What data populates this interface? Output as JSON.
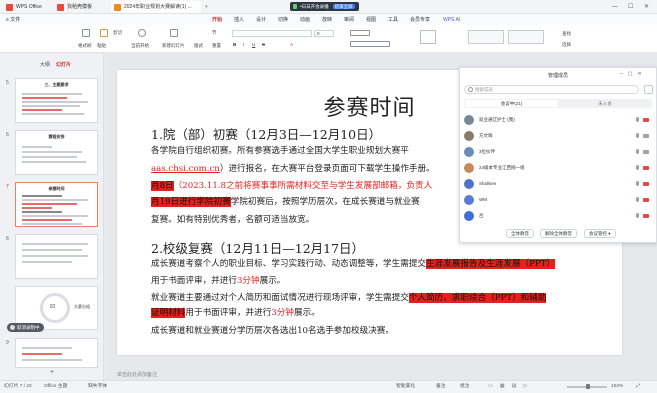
{
  "tabs": [
    {
      "label": "WPS Office",
      "color": "#e84b3c"
    },
    {
      "label": "找稻壳模板",
      "color": "#e84b3c"
    },
    {
      "label": "2024年职业规划大赛解读(1) ...",
      "color": "#f08a24"
    }
  ],
  "meeting_badge": {
    "label": "•日日开会录播",
    "fullscreen": "结束全屏"
  },
  "window_controls": {
    "min": "—",
    "max": "☐",
    "close": "✕"
  },
  "menu": {
    "file": "≡ 文件",
    "items": [
      "开始",
      "插入",
      "设计",
      "切换",
      "动画",
      "放映",
      "审阅",
      "视图",
      "工具",
      "会员专享"
    ],
    "ai": "WPS AI",
    "active": "开始"
  },
  "toolbar": {
    "format_painter": "格式刷",
    "paste": "粘贴",
    "cut": "剪切",
    "current_start": "当前开始",
    "new_slide": "新建幻灯片",
    "layout": "版式",
    "section": "节",
    "reset": "重置",
    "font_size": "0",
    "find": "查找",
    "select": "选择"
  },
  "left_panel": {
    "tabs": [
      "大纲",
      "幻灯片"
    ],
    "active_tab": "幻灯片",
    "thumbs": [
      {
        "num": "5",
        "title": "三、主题要求"
      },
      {
        "num": "6",
        "title": "赛程安排"
      },
      {
        "num": "7",
        "title": "参赛时间"
      },
      {
        "num": "8",
        "title": ""
      },
      {
        "num": "9",
        "title": ""
      }
    ],
    "mini_chart_value": "82",
    "mini_chart_label": "大赛分组",
    "recording_label": "取消录制中"
  },
  "slide": {
    "title": "参赛时间",
    "sec1_heading": "1.院（部）初赛（12月3日—12月10日）",
    "p1_line1": "各学院自行组织初赛。所有参赛选手通过全国大学生职业规划大赛平",
    "p1_line2_link": "aas.chsi.com.cn",
    "p1_line2_rest": "）进行报名，在大赛平台登录页面可下载学生操作手册。",
    "p1_line3_hl": "月8日",
    "p1_line3_red": "（2023.11.8之前将赛事事所需材料交至与学生发展部邮箱，负责人",
    "p1_line4_hl": "月19日进行学院初赛",
    "p1_line4_rest": "学院初赛后，按照学历层次，在成长赛道与就业赛",
    "p1_line5": "复赛。如有特别优秀者，名额可适当放宽。",
    "sec2_heading": "2.校级复赛（12月11日—12月17日）",
    "p2_line1_pre": "成长赛道考察个人的职业目标、学习实践行动、动态调整等，学生需提交",
    "p2_line1_hl": "生涯发展报告及生涯发展（PPT）",
    "p2_line2_pre": "用于书面评审，并进行",
    "p2_line2_red": "3分钟",
    "p2_line2_post": "展示。",
    "p2_line3_pre": "就业赛道主要通过对个人简历和面试情况进行现场评审，学生需提交",
    "p2_line3_hl": "个人简历、求职综合（PPT）和辅助",
    "p2_line4_hl": "证明材料",
    "p2_line4_pre": "用于书面评审，并进行",
    "p2_line4_red": "3分钟",
    "p2_line4_post": "展示。",
    "p2_line5": "成长赛道和就业赛道分学历层次各选出10名选手参加校级决赛。"
  },
  "notes_placeholder": "单击此处添加备注",
  "meeting_panel": {
    "title": "管理成员",
    "search_placeholder": "搜索成员",
    "seg_in": "会议中(21)",
    "seg_out": "未入会",
    "members": [
      {
        "name": "就业通辽护士 (我)",
        "color": "#7a8797",
        "mic": "on",
        "cam": "red"
      },
      {
        "name": "方文辉",
        "color": "#8a7a6a",
        "mic": "off",
        "cam": "off"
      },
      {
        "name": "3位伙伴",
        "color": "#6b8cb5",
        "mic": "off",
        "cam": "off"
      },
      {
        "name": "24级本专业江西婉一组",
        "color": "#c58b5a",
        "mic": "off",
        "cam": "red"
      },
      {
        "name": "Shallsen",
        "color": "#4d74c9",
        "mic": "off",
        "cam": "red"
      },
      {
        "name": "WM",
        "color": "#5a7bd1",
        "mic": "off",
        "cam": "red"
      },
      {
        "name": "吕",
        "color": "#3f6fd6",
        "mic": "off",
        "cam": "red"
      }
    ],
    "btn_mute_all": "全体静音",
    "btn_unmute_all": "解除全体静音",
    "btn_manage": "会议管控 ▾"
  },
  "status": {
    "slide_count": "幻灯片 7 / 22",
    "theme": "Office 主题",
    "missing_font": "缺失字体",
    "smart_beautify": "智能美化",
    "notes": "备注",
    "comment": "批注",
    "zoom": "102%"
  }
}
